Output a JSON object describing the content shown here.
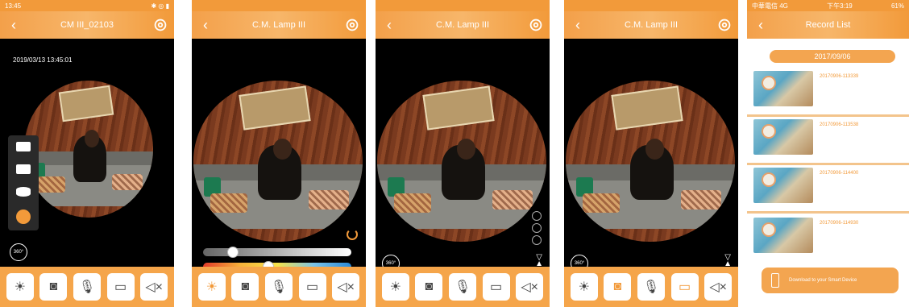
{
  "screen1": {
    "status_time": "13:45",
    "title": "CM III_02103",
    "timestamp": "2019/03/13 13:45:01",
    "btn360": "360°"
  },
  "screen2": {
    "title": "C.M. Lamp III"
  },
  "screen3": {
    "title": "C.M. Lamp III",
    "btn360": "360°"
  },
  "screen4": {
    "title": "C.M. Lamp III",
    "btn360": "360°"
  },
  "screen5": {
    "status_carrier": "中華電信 4G",
    "status_time": "下午3:19",
    "status_battery": "61%",
    "title": "Record List",
    "date": "2017/09/06",
    "records": [
      "20170906-113339",
      "20170906-113538",
      "20170906-114400",
      "20170906-114930"
    ],
    "download_label": "Download to your Smart Device"
  },
  "colors": {
    "accent": "#f29a3a",
    "toolbar": "#f5a54a"
  },
  "toolbar_icons": [
    "brightness-icon",
    "camera-icon",
    "microphone-icon",
    "video-record-icon",
    "speaker-mute-icon"
  ]
}
